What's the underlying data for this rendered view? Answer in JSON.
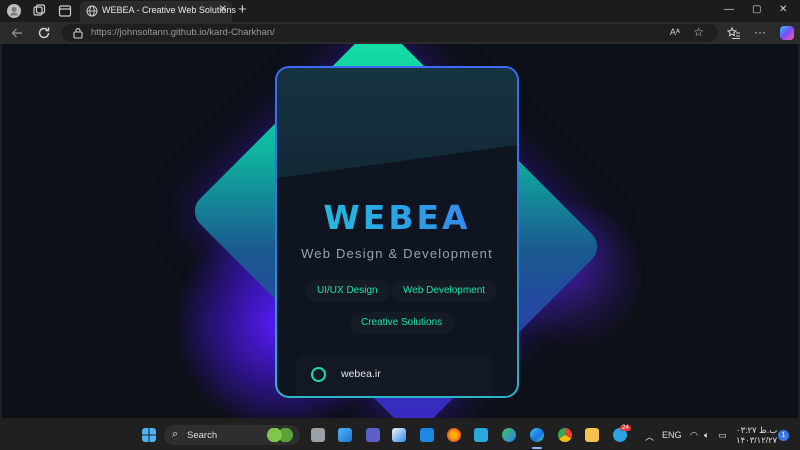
{
  "browser": {
    "tab_title": "WEBEA - Creative Web Solutions",
    "tab_close": "✕",
    "new_tab": "+",
    "url_domain": "https://johnsoltann.github.io",
    "url_path": "/kard-Charkhan/",
    "read_aloud": "Aᴬ",
    "window_controls": [
      "—",
      "▢",
      "✕"
    ]
  },
  "card": {
    "brand": "WEBEA",
    "tagline": "Web Design & Development",
    "services": [
      "UI/UX Design",
      "Web Development",
      "Creative Solutions"
    ],
    "contact_site": "webea.ir"
  },
  "taskbar": {
    "search_label": "Search",
    "language": "ENG",
    "time": "۰۳:۲۷ ب.ظ",
    "date": "۱۴۰۳/۱۲/۲۷",
    "notification_count": "1",
    "badge_count": "24"
  },
  "colors": {
    "accent_green": "#19e0a6",
    "accent_blue": "#3b7bf0",
    "page_bg": "#0c1017"
  }
}
